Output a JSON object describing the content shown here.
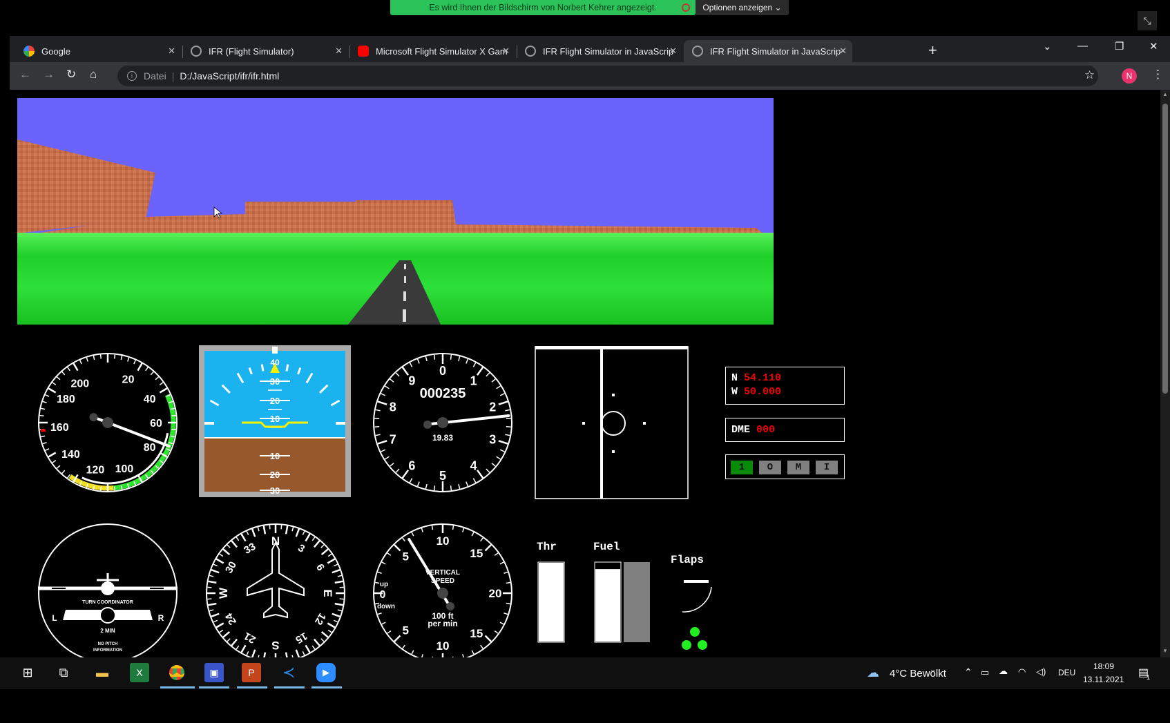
{
  "screen_share": {
    "message": "Es wird Ihnen der Bildschirm von Norbert Kehrer angezeigt.",
    "options_label": "Optionen anzeigen ⌄"
  },
  "tabs": [
    {
      "title": "Google",
      "favicon_color": "#ffffff"
    },
    {
      "title": "IFR (Flight Simulator)",
      "favicon_color": "#9aa0a6"
    },
    {
      "title": "Microsoft Flight Simulator X Gam",
      "favicon_color": "#ff0000"
    },
    {
      "title": "IFR Flight Simulator in JavaScript",
      "favicon_color": "#9aa0a6"
    },
    {
      "title": "IFR Flight Simulator in JavaScript",
      "favicon_color": "#9aa0a6"
    }
  ],
  "address_bar": {
    "scheme_label": "Datei",
    "url": "D:/JavaScript/ifr/ifr.html",
    "avatar_letter": "N"
  },
  "icons": [
    "back-icon",
    "forward-icon",
    "reload-icon",
    "home-icon",
    "star-icon",
    "menu-icon",
    "close-icon",
    "plus-icon",
    "minimize-icon",
    "restore-icon"
  ],
  "colors": {
    "sky": "#6a63fc",
    "ground": "#2ee03a",
    "runway": "#3a3a3a",
    "attitude_sky": "#1ab3f0",
    "attitude_ground": "#97582c",
    "readout_red": "#ee0000",
    "mode_active": "#0a8a0a",
    "gear_green": "#22ee22"
  },
  "instruments": {
    "airspeed": {
      "labels": [
        "200",
        "20",
        "40",
        "60",
        "80",
        "100",
        "120",
        "140",
        "160",
        "180"
      ],
      "needle_value": 62
    },
    "attitude": {
      "pitch_up": [
        "30",
        "20",
        "10"
      ],
      "pitch_down": [
        "10",
        "20",
        "30"
      ],
      "top_mark": "40"
    },
    "altimeter": {
      "digits": [
        "0",
        "1",
        "2",
        "3",
        "4",
        "5",
        "6",
        "7",
        "8",
        "9"
      ],
      "altitude": "000235",
      "pressure": "19.83"
    },
    "vor": {},
    "turn_coordinator": {
      "title": "TURN COORDINATOR",
      "left": "L",
      "right": "R",
      "min": "2 MIN",
      "note1": "NO PITCH",
      "note2": "INFORMATION"
    },
    "heading": {
      "labels": [
        "N",
        "3",
        "6",
        "E",
        "12",
        "15",
        "S",
        "21",
        "24",
        "W",
        "30",
        "33"
      ]
    },
    "vsi": {
      "title1": "VERTICAL",
      "title2": "SPEED",
      "units1": "100 ft",
      "units2": "per min",
      "up": "up",
      "down": "down",
      "zero": "0",
      "labels": [
        "5",
        "10",
        "15",
        "20",
        "15",
        "10",
        "5"
      ]
    }
  },
  "nav": {
    "lat_prefix": "N",
    "lat_value": "54.110",
    "lon_prefix": "W",
    "lon_value": "50.000",
    "dme_label": "DME",
    "dme_value": "000",
    "modes": [
      "1",
      "O",
      "M",
      "I"
    ],
    "active_mode": "1"
  },
  "controls": {
    "throttle_label": "Thr",
    "fuel_label": "Fuel",
    "flaps_label": "Flaps",
    "throttle_level": 1.0,
    "fuel_left_level": 0.92,
    "fuel_right_level": 1.0
  },
  "taskbar": {
    "weather": "4°C  Bewölkt",
    "language": "DEU",
    "time": "18:09",
    "date": "13.11.2021",
    "notifications": "1"
  }
}
